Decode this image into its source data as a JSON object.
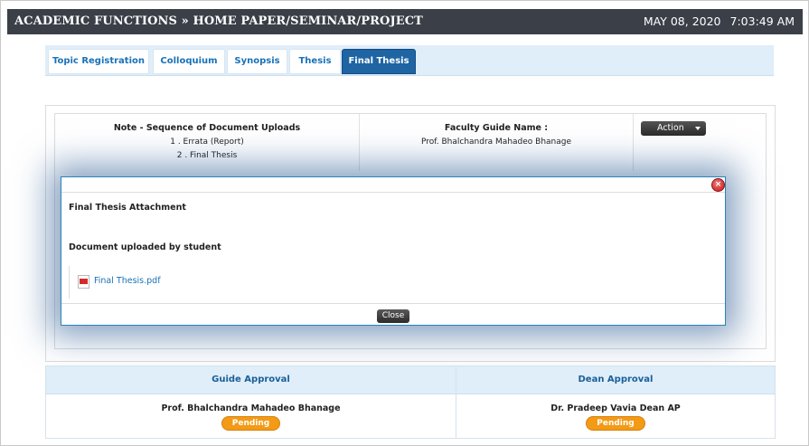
{
  "header": {
    "title": "ACADEMIC FUNCTIONS » HOME PAPER/SEMINAR/PROJECT",
    "date": "MAY 08, 2020",
    "time": "7:03:49 AM"
  },
  "tabs": [
    {
      "label": "Topic Registration",
      "active": false
    },
    {
      "label": "Colloquium",
      "active": false
    },
    {
      "label": "Synopsis",
      "active": false
    },
    {
      "label": "Thesis",
      "active": false
    },
    {
      "label": "Final Thesis",
      "active": true
    }
  ],
  "note": {
    "title": "Note - Sequence of Document Uploads",
    "items": [
      "1 . Errata (Report)",
      "2 . Final Thesis"
    ]
  },
  "guide": {
    "title": "Faculty Guide Name  :",
    "name": "Prof. Bhalchandra Mahadeo Bhanage"
  },
  "action_label": "Action",
  "modal": {
    "title": "Final Thesis Attachment",
    "subtitle": "Document uploaded by student",
    "file_name": "Final Thesis.pdf",
    "close_label": "Close",
    "close_icon_glyph": "×"
  },
  "approval": {
    "guide_header": "Guide Approval",
    "dean_header": "Dean Approval",
    "guide_name": "Prof. Bhalchandra Mahadeo Bhanage",
    "dean_name": "Dr. Pradeep Vavia Dean AP",
    "guide_status": "Pending",
    "dean_status": "Pending"
  },
  "colors": {
    "header_bg": "#3a3f48",
    "tab_active": "#1f64a3",
    "link": "#1a72b7",
    "pending_badge": "#f39a16"
  }
}
